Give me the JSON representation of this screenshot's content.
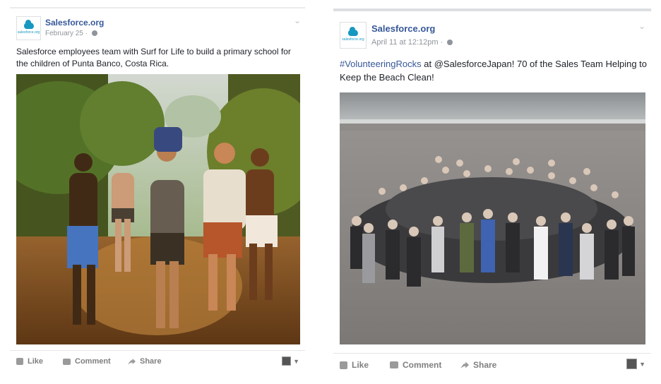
{
  "post1": {
    "page_name": "Salesforce.org",
    "logo_text": "salesforce.org",
    "date": "February 25 · ",
    "text": "Salesforce employees team with Surf for Life to build a primary school for the children of Punta Banco, Costa Rica.",
    "actions": {
      "like": "Like",
      "comment": "Comment",
      "share": "Share"
    }
  },
  "post2": {
    "page_name": "Salesforce.org",
    "logo_text": "salesforce.org",
    "date": "April 11 at 12:12pm · ",
    "hashtag": "#VolunteeringRocks",
    "text_rest": " at @SalesforceJapan! 70 of the Sales Team Helping to Keep the Beach Clean!",
    "actions": {
      "like": "Like",
      "comment": "Comment",
      "share": "Share"
    }
  },
  "icons": [
    "globe-icon",
    "chevron-down-icon",
    "like-icon",
    "comment-icon",
    "share-icon",
    "page-avatar-icon"
  ],
  "colors": {
    "link": "#365899",
    "meta": "#90949c",
    "brand": "#1798c1"
  }
}
